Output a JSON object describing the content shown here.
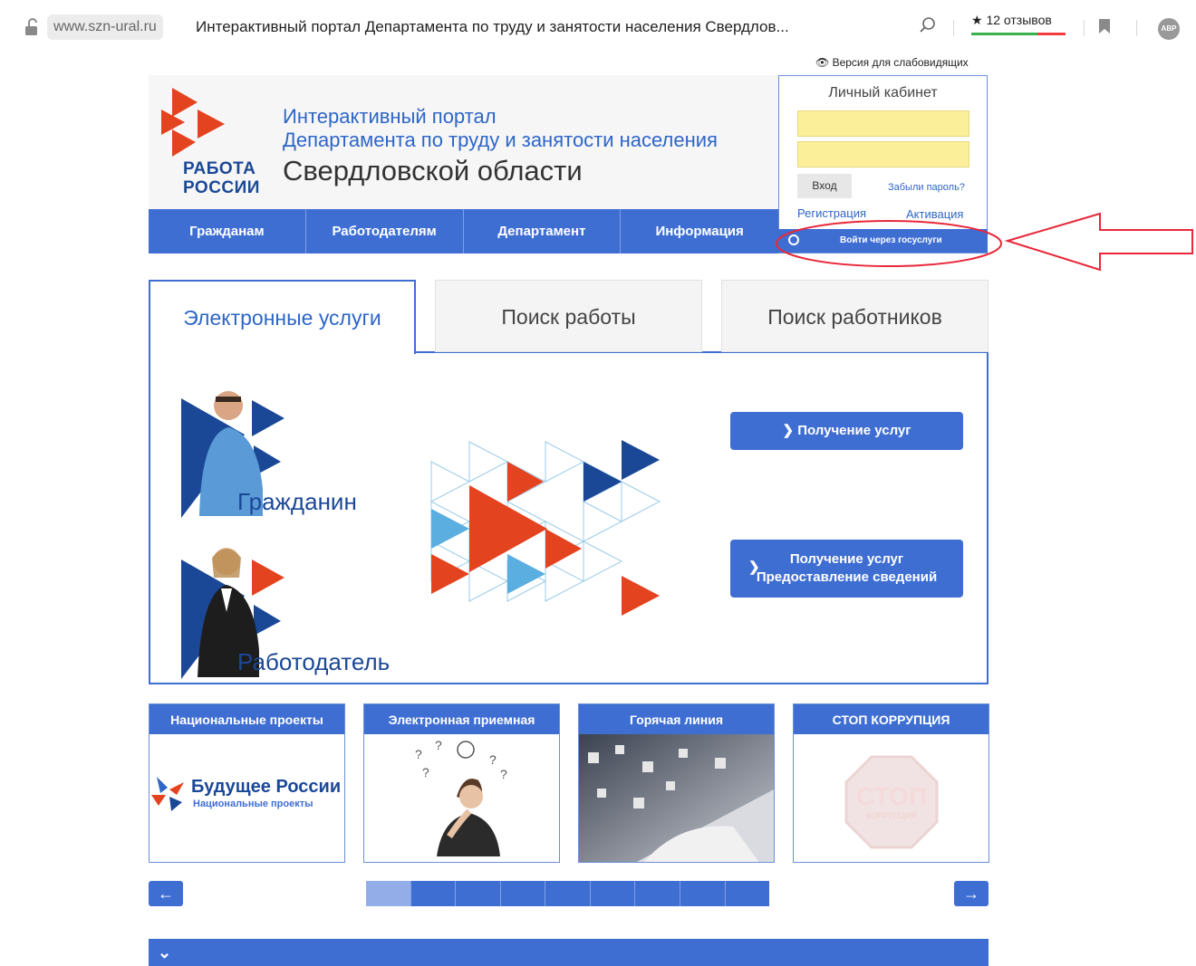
{
  "browser": {
    "domain": "www.szn-ural.ru",
    "title": "Интерактивный портал Департамента по труду и занятости населения Свердлов...",
    "reviews": "12 отзывов",
    "abp": "ABP"
  },
  "header": {
    "vision_link": "Версия для слабовидящих",
    "logo_line1": "РАБОТА",
    "logo_line2": "РОССИИ",
    "portal_line1": "Интерактивный портал",
    "portal_line2": "Департамента по труду и занятости населения",
    "portal_line3": "Свердловской области"
  },
  "nav": [
    "Гражданам",
    "Работодателям",
    "Департамент",
    "Информация"
  ],
  "login": {
    "title": "Личный кабинет",
    "login_button": "Вход",
    "forgot": "Забыли пароль?",
    "register": "Регистрация",
    "activate": "Активация",
    "gosuslugi": "Войти через госуслуги"
  },
  "tabs": [
    "Электронные услуги",
    "Поиск работы",
    "Поиск работников"
  ],
  "services": {
    "citizen_label": "Гражданин",
    "employer_label": "Работодатель",
    "btn_citizen": "Получение услуг",
    "btn_employer_line1": "Получение услуг",
    "btn_employer_line2": "Предоставление сведений"
  },
  "cards": [
    {
      "title": "Национальные проекты",
      "brand": "Будущее России",
      "brand_sub": "Национальные проекты"
    },
    {
      "title": "Электронная приемная"
    },
    {
      "title": "Горячая линия"
    },
    {
      "title": "СТОП КОРРУПЦИЯ",
      "stamp": "СТОП",
      "stamp_sub": "КОРРУПЦИЯ"
    }
  ],
  "pager": {
    "pages": 9,
    "active_index": 0
  },
  "colors": {
    "primary": "#3f6ed3",
    "logo_red": "#e4431f",
    "logo_blue": "#1b4896",
    "highlight_red": "#e8283a"
  }
}
